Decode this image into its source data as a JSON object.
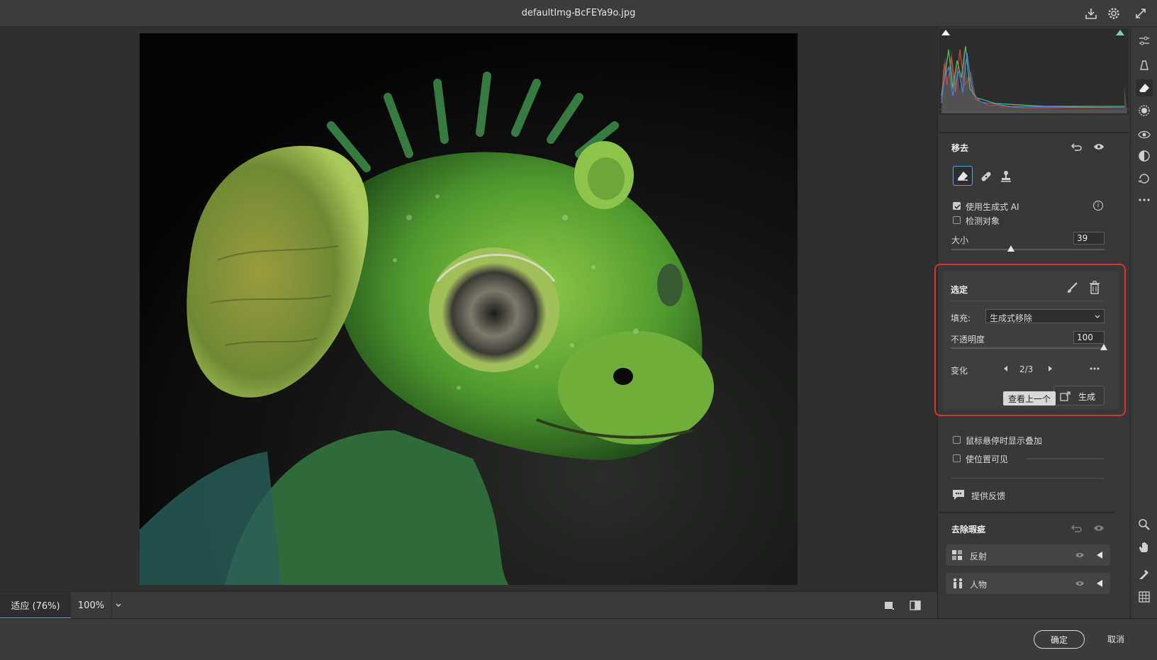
{
  "window": {
    "title": "defaultImg-BcFEYa9o.jpg"
  },
  "zoom": {
    "fit_label": "适应 (76%)",
    "percent_label": "100%"
  },
  "footer": {
    "ok_label": "确定",
    "cancel_label": "取消"
  },
  "remove": {
    "title": "移去",
    "use_generative_ai_label": "使用生成式 AI",
    "use_generative_ai_checked": true,
    "detect_objects_label": "检测对象",
    "detect_objects_checked": false,
    "size_label": "大小",
    "size_value": "39",
    "size_level": 0.39
  },
  "selection": {
    "title": "选定",
    "fill_label": "填充:",
    "fill_value": "生成式移除",
    "opacity_label": "不透明度",
    "opacity_value": "100",
    "opacity_level": 1.0,
    "variation_label": "变化",
    "variation_value": "2/3",
    "tooltip": "查看上一个",
    "generate_label": "生成"
  },
  "options": {
    "show_overlay_label": "鼠标悬停时显示叠加",
    "show_overlay_checked": false,
    "visualize_spots_label": "使位置可见",
    "visualize_spots_checked": false,
    "feedback_label": "提供反馈"
  },
  "distraction": {
    "title": "去除瑕疵",
    "items": [
      {
        "label": "反射"
      },
      {
        "label": "人物"
      }
    ]
  },
  "colors": {
    "highlight_border": "#e0302a",
    "accent": "#5aa0e6"
  }
}
